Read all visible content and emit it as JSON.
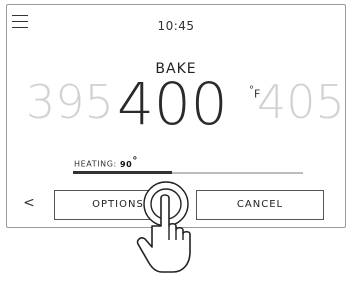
{
  "header": {
    "time": "10:45"
  },
  "oven": {
    "mode": "BAKE",
    "temperatures": {
      "prev": "395",
      "current": "400",
      "next": "405"
    },
    "unit_symbol": "°",
    "unit_letter": "F"
  },
  "heating": {
    "label": "HEATING:",
    "value": "90",
    "value_deg": "°",
    "progress": 0.43
  },
  "buttons": {
    "options": "OPTIONS",
    "cancel": "CANCEL",
    "back": "<"
  },
  "icons": {
    "menu": "hamburger-menu-icon",
    "hand": "tap-hand-icon",
    "back": "chevron-left-icon"
  },
  "colors": {
    "dim_number": "#d2d2d2",
    "primary_text": "#2a2a2a",
    "border": "#555555"
  }
}
